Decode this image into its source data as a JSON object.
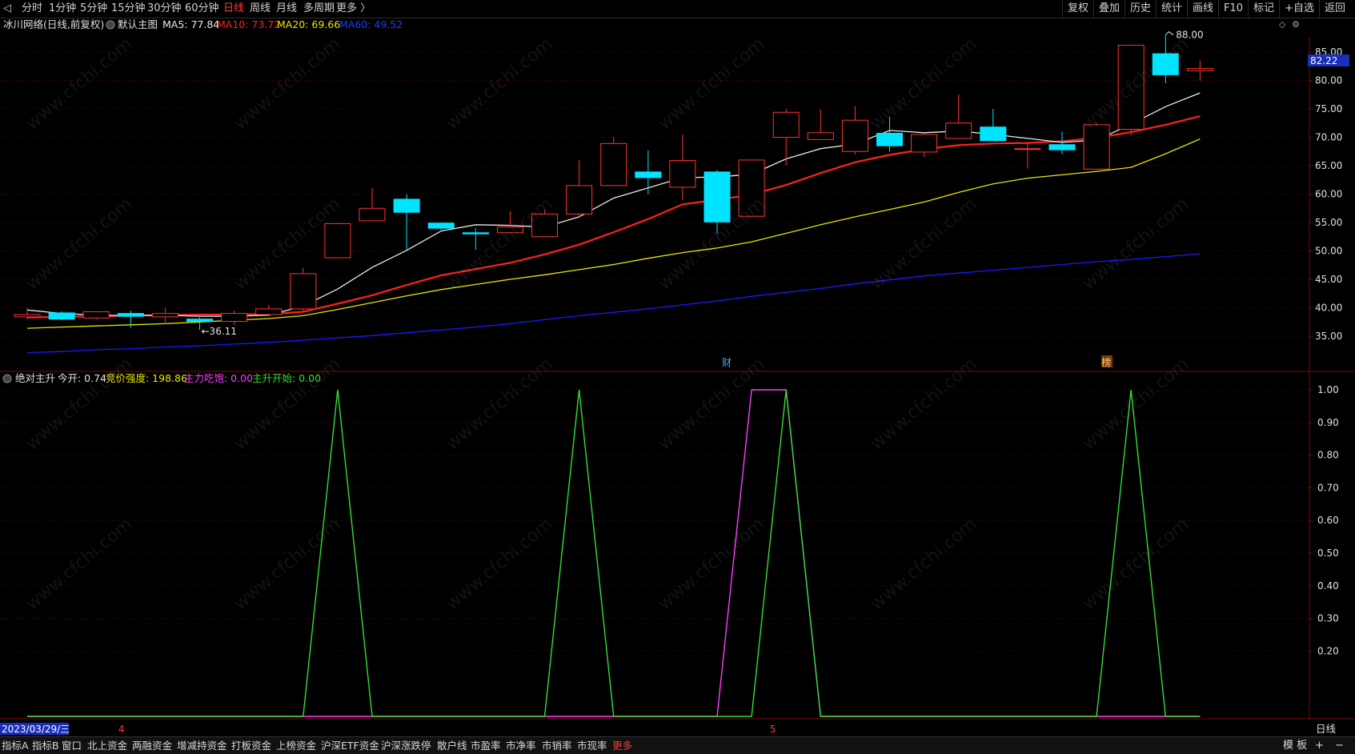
{
  "toolbar": {
    "periods": [
      "分时",
      "1分钟",
      "5分钟",
      "15分钟",
      "30分钟",
      "60分钟",
      "日线",
      "周线",
      "月线",
      "多周期",
      "更多 〉"
    ],
    "active_period": "日线",
    "right_buttons": [
      "复权",
      "叠加",
      "历史",
      "统计",
      "画线",
      "F10",
      "标记",
      "+自选",
      "返回"
    ]
  },
  "main_chart": {
    "stock_title": "冰川网络(日线,前复权)",
    "main_chart_label": "默认主图",
    "ma5_label": "MA5: 77.84",
    "ma10_label": "MA10: 73.72",
    "ma20_label": "MA20: 69.66",
    "ma60_label": "MA60: 49.52",
    "current_price_tag": "82.22",
    "high_annotation": "88.00",
    "low_annotation": "36.11",
    "event_marker_finance": "财",
    "event_marker_rank": "榜",
    "colors": {
      "up": "#ff3232",
      "down": "#00e5ff",
      "ma5": "#e8e8e8",
      "ma10": "#ff2020",
      "ma20": "#e6e600",
      "ma60": "#1a1aff"
    }
  },
  "indicator": {
    "name": "绝对主升",
    "today_open_label": "今开: 0.74",
    "auction_strength_label": "竞价强度: 198.86",
    "main_force_label": "主力吃饱: 0.00",
    "main_rise_label": "主升开始: 0.00"
  },
  "axis": {
    "date_label": "2023/03/29/三",
    "month_marks": [
      "4",
      "5"
    ],
    "period_label": "日线"
  },
  "chart_data": {
    "type": "candlestick",
    "price_axis_ticks": [
      "85.00",
      "80.00",
      "75.00",
      "70.00",
      "65.00",
      "60.00",
      "55.00",
      "50.00",
      "45.00",
      "40.00",
      "35.00"
    ],
    "price_range": [
      31,
      89.5
    ],
    "candles": [
      {
        "o": 38.4,
        "c": 38.8,
        "h": 40.0,
        "l": 38.0
      },
      {
        "o": 39.1,
        "c": 38.0,
        "h": 39.4,
        "l": 37.8
      },
      {
        "o": 38.2,
        "c": 39.3,
        "h": 39.4,
        "l": 37.9
      },
      {
        "o": 39.0,
        "c": 38.5,
        "h": 39.5,
        "l": 36.5
      },
      {
        "o": 38.4,
        "c": 39.0,
        "h": 40.0,
        "l": 37.4
      },
      {
        "o": 38.0,
        "c": 37.6,
        "h": 38.3,
        "l": 36.1
      },
      {
        "o": 37.6,
        "c": 39.0,
        "h": 39.5,
        "l": 37.0
      },
      {
        "o": 38.8,
        "c": 39.8,
        "h": 40.5,
        "l": 38.5
      },
      {
        "o": 39.8,
        "c": 46.0,
        "h": 47.0,
        "l": 39.5
      },
      {
        "o": 48.8,
        "c": 54.8,
        "h": 54.9,
        "l": 48.8
      },
      {
        "o": 55.3,
        "c": 57.5,
        "h": 61.1,
        "l": 55.3
      },
      {
        "o": 59.1,
        "c": 56.8,
        "h": 60.0,
        "l": 50.2
      },
      {
        "o": 54.9,
        "c": 54.0,
        "h": 55.0,
        "l": 53.7
      },
      {
        "o": 53.2,
        "c": 53.0,
        "h": 54.0,
        "l": 50.2
      },
      {
        "o": 53.2,
        "c": 54.2,
        "h": 57.0,
        "l": 53.1
      },
      {
        "o": 52.5,
        "c": 56.5,
        "h": 57.2,
        "l": 52.5
      },
      {
        "o": 56.5,
        "c": 61.5,
        "h": 66.0,
        "l": 56.0
      },
      {
        "o": 61.5,
        "c": 68.9,
        "h": 70.0,
        "l": 61.5
      },
      {
        "o": 63.9,
        "c": 62.9,
        "h": 67.7,
        "l": 60.0
      },
      {
        "o": 61.2,
        "c": 65.9,
        "h": 70.5,
        "l": 59.0
      },
      {
        "o": 63.9,
        "c": 55.1,
        "h": 64.2,
        "l": 53.0
      },
      {
        "o": 56.1,
        "c": 66.0,
        "h": 66.0,
        "l": 56.0
      },
      {
        "o": 70.0,
        "c": 74.4,
        "h": 75.0,
        "l": 65.0
      },
      {
        "o": 69.6,
        "c": 70.8,
        "h": 74.9,
        "l": 69.6
      },
      {
        "o": 67.5,
        "c": 73.0,
        "h": 75.5,
        "l": 67.0
      },
      {
        "o": 70.7,
        "c": 68.5,
        "h": 73.5,
        "l": 67.5
      },
      {
        "o": 67.4,
        "c": 70.5,
        "h": 70.5,
        "l": 66.5
      },
      {
        "o": 69.8,
        "c": 72.5,
        "h": 77.5,
        "l": 69.8
      },
      {
        "o": 71.8,
        "c": 69.4,
        "h": 75.0,
        "l": 69.4
      },
      {
        "o": 68.0,
        "c": 68.0,
        "h": 69.0,
        "l": 64.5
      },
      {
        "o": 68.7,
        "c": 67.8,
        "h": 71.0,
        "l": 67.0
      },
      {
        "o": 64.4,
        "c": 72.2,
        "h": 72.5,
        "l": 64.4
      },
      {
        "o": 71.4,
        "c": 86.2,
        "h": 86.2,
        "l": 70.3
      },
      {
        "o": 84.7,
        "c": 81.0,
        "h": 88.0,
        "l": 79.5
      },
      {
        "o": 81.7,
        "c": 82.1,
        "h": 83.5,
        "l": 80.0
      }
    ],
    "ma5": [
      39.6,
      39.0,
      38.7,
      38.6,
      38.7,
      38.5,
      38.5,
      38.7,
      40.3,
      43.3,
      47.1,
      50.1,
      53.5,
      54.6,
      54.5,
      54.2,
      56.0,
      59.3,
      61.1,
      62.9,
      63.0,
      63.5,
      66.2,
      68.0,
      68.8,
      71.2,
      70.8,
      71.1,
      70.5,
      69.8,
      69.1,
      69.5,
      72.3,
      75.4,
      77.8
    ],
    "ma10": [
      38.3,
      38.4,
      38.5,
      38.6,
      38.7,
      38.8,
      38.8,
      38.9,
      39.3,
      40.7,
      42.2,
      44.0,
      45.7,
      46.8,
      47.9,
      49.4,
      51.1,
      53.3,
      55.6,
      58.2,
      59.0,
      59.9,
      61.6,
      63.7,
      65.6,
      66.9,
      67.9,
      68.6,
      68.9,
      69.0,
      69.3,
      69.9,
      70.9,
      72.2,
      73.7
    ],
    "ma20": [
      36.4,
      36.6,
      36.8,
      37.0,
      37.2,
      37.5,
      37.8,
      38.1,
      38.6,
      39.7,
      40.9,
      42.1,
      43.2,
      44.1,
      45.0,
      45.8,
      46.7,
      47.6,
      48.7,
      49.7,
      50.5,
      51.6,
      53.1,
      54.6,
      56.0,
      57.3,
      58.6,
      60.3,
      61.8,
      62.8,
      63.4,
      64.0,
      64.7,
      67.1,
      69.7
    ],
    "ma60": [
      32.1,
      32.3,
      32.6,
      32.8,
      33.1,
      33.3,
      33.6,
      33.9,
      34.3,
      34.7,
      35.1,
      35.6,
      36.1,
      36.6,
      37.2,
      37.9,
      38.6,
      39.2,
      39.8,
      40.5,
      41.2,
      42.0,
      42.7,
      43.4,
      44.2,
      44.9,
      45.6,
      46.1,
      46.6,
      47.1,
      47.6,
      48.1,
      48.5,
      49.0,
      49.5
    ],
    "indicator_axis_ticks": [
      "1.00",
      "0.90",
      "0.80",
      "0.70",
      "0.60",
      "0.50",
      "0.40",
      "0.30",
      "0.20"
    ],
    "indicator_range": [
      0,
      1
    ],
    "signal_main_rise": [
      0,
      0,
      0,
      0,
      0,
      0,
      0,
      0,
      0,
      1,
      0,
      0,
      0,
      0,
      0,
      0,
      1,
      0,
      0,
      0,
      0,
      0,
      1,
      0,
      0,
      0,
      0,
      0,
      0,
      0,
      0,
      0,
      1,
      0,
      0
    ],
    "signal_main_force": [
      0,
      0,
      0,
      0,
      0,
      0,
      0,
      0,
      0,
      0,
      0,
      0,
      0,
      0,
      0,
      0,
      0,
      0,
      0,
      0,
      0,
      1,
      1,
      0,
      0,
      0,
      0,
      0,
      0,
      0,
      0,
      0,
      0,
      0,
      0
    ]
  }
}
